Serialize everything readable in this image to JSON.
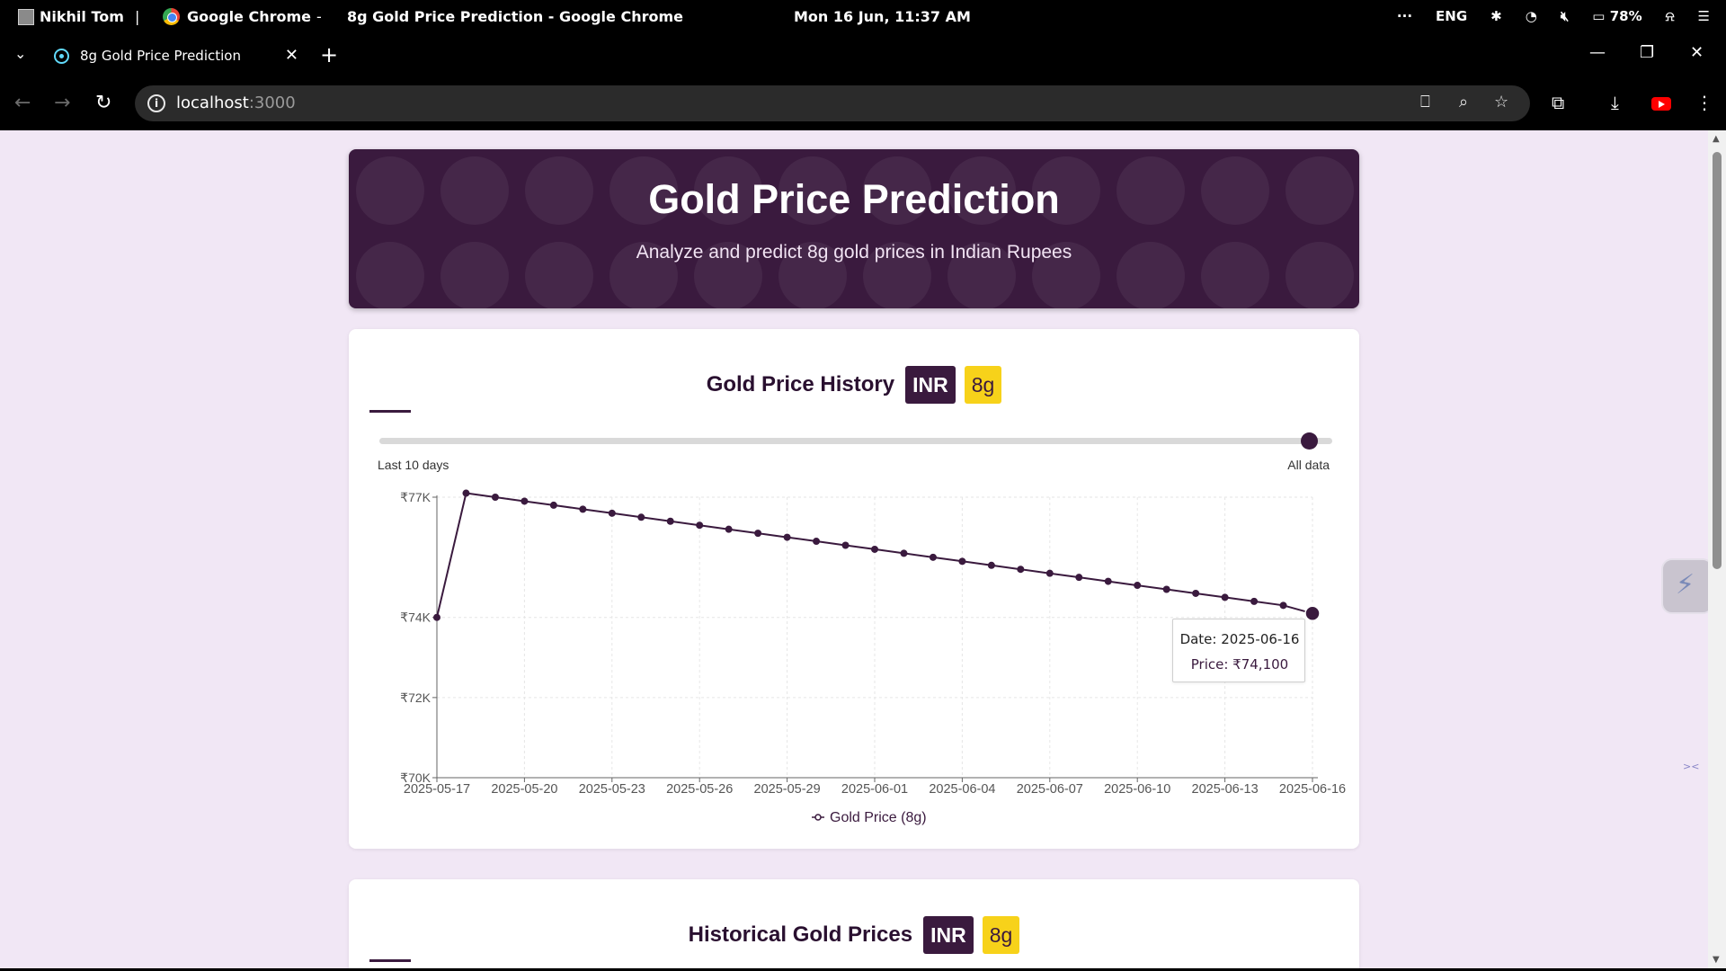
{
  "os": {
    "user": "Nikhil Tom",
    "separator": "|",
    "app_name": "Google Chrome",
    "dash": "-",
    "window_title": "8g Gold Price Prediction - Google Chrome",
    "clock": "Mon 16 Jun, 11:37 AM",
    "tray": {
      "more": "···",
      "language": "ENG",
      "battery": "78%"
    }
  },
  "browser": {
    "tab_title": "8g Gold Price Prediction",
    "url_host": "localhost",
    "url_port": ":3000"
  },
  "hero": {
    "title": "Gold Price Prediction",
    "subtitle": "Analyze and predict 8g gold prices in Indian Rupees"
  },
  "history_card": {
    "title": "Gold Price History",
    "badge_currency": "INR",
    "badge_weight": "8g",
    "slider_min_label": "Last 10 days",
    "slider_max_label": "All data",
    "slider_value": 1.0
  },
  "chart_data": {
    "type": "line",
    "title": "",
    "xlabel": "",
    "ylabel": "",
    "ylim": [
      70000,
      77000
    ],
    "yticks": [
      "₹70K",
      "₹72K",
      "₹74K",
      "₹77K"
    ],
    "ytick_values": [
      70000,
      72000,
      74000,
      77000
    ],
    "xticks": [
      "2025-05-17",
      "2025-05-20",
      "2025-05-23",
      "2025-05-26",
      "2025-05-29",
      "2025-06-01",
      "2025-06-04",
      "2025-06-07",
      "2025-06-10",
      "2025-06-13",
      "2025-06-16"
    ],
    "grid": true,
    "legend": "bottom",
    "series": [
      {
        "name": "Gold Price (8g)",
        "color": "#3a1a3e",
        "x": [
          "2025-05-17",
          "2025-05-18",
          "2025-05-19",
          "2025-05-20",
          "2025-05-21",
          "2025-05-22",
          "2025-05-23",
          "2025-05-24",
          "2025-05-25",
          "2025-05-26",
          "2025-05-27",
          "2025-05-28",
          "2025-05-29",
          "2025-05-30",
          "2025-05-31",
          "2025-06-01",
          "2025-06-02",
          "2025-06-03",
          "2025-06-04",
          "2025-06-05",
          "2025-06-06",
          "2025-06-07",
          "2025-06-08",
          "2025-06-09",
          "2025-06-10",
          "2025-06-11",
          "2025-06-12",
          "2025-06-13",
          "2025-06-14",
          "2025-06-15",
          "2025-06-16"
        ],
        "values": [
          74000,
          77100,
          77000,
          76900,
          76800,
          76700,
          76600,
          76500,
          76400,
          76300,
          76200,
          76100,
          76000,
          75900,
          75800,
          75700,
          75600,
          75500,
          75400,
          75300,
          75200,
          75100,
          75000,
          74900,
          74800,
          74700,
          74600,
          74500,
          74400,
          74300,
          74100
        ]
      }
    ],
    "tooltip": {
      "date_label": "Date: 2025-06-16",
      "price_label": "Price: ₹74,100"
    }
  },
  "historical_card": {
    "title": "Historical Gold Prices",
    "badge_currency": "INR",
    "badge_weight": "8g"
  },
  "colors": {
    "primary": "#3a1a3e",
    "accent": "#f7d21a",
    "background": "#f1e7f5"
  }
}
